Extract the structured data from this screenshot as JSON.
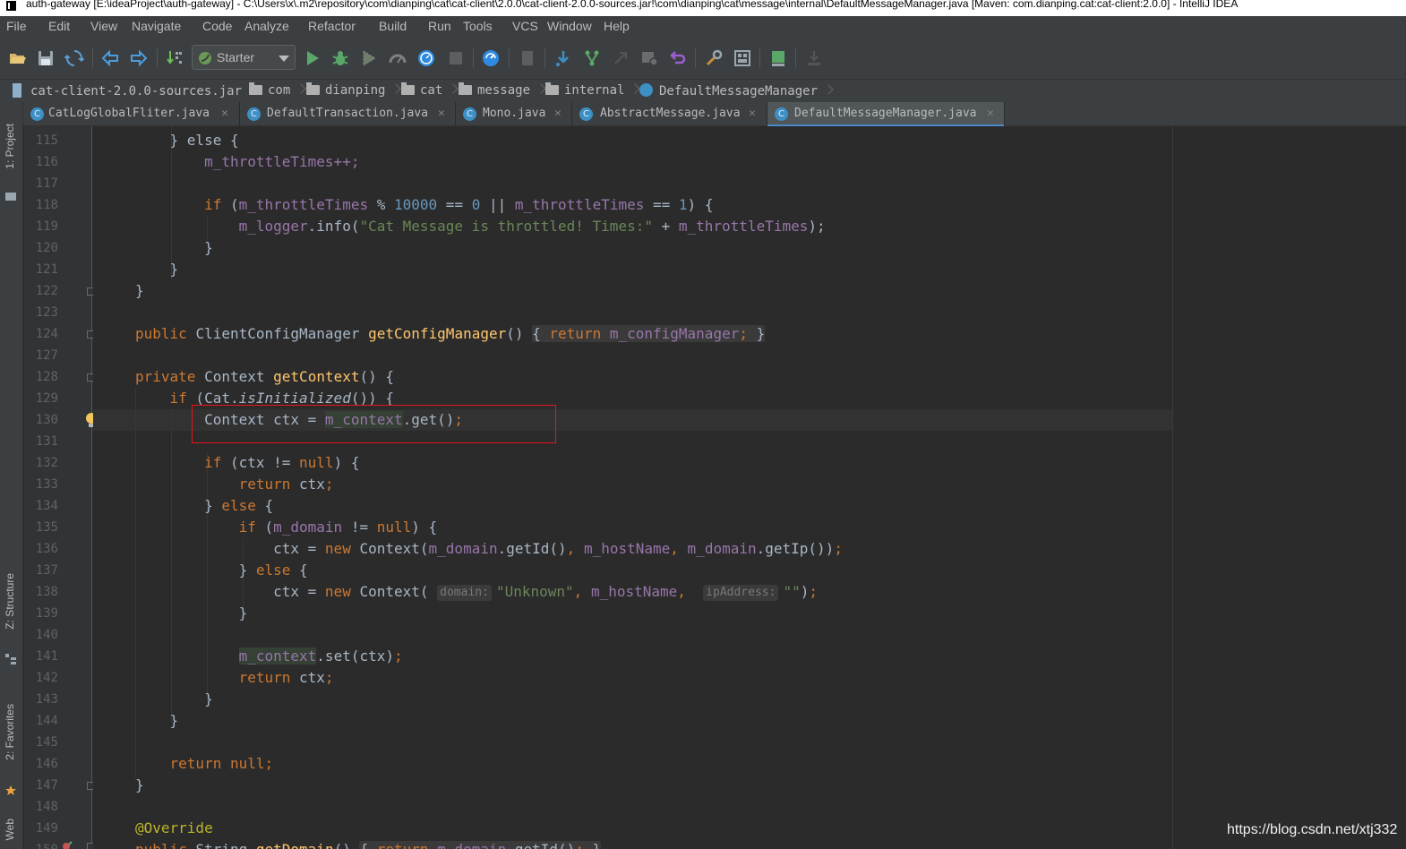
{
  "window": {
    "title": "auth-gateway [E:\\ideaProject\\auth-gateway] - C:\\Users\\x\\.m2\\repository\\com\\dianping\\cat\\cat-client\\2.0.0\\cat-client-2.0.0-sources.jar!\\com\\dianping\\cat\\message\\internal\\DefaultMessageManager.java [Maven: com.dianping.cat:cat-client:2.0.0] - IntelliJ IDEA"
  },
  "menu": [
    "File",
    "Edit",
    "View",
    "Navigate",
    "Code",
    "Analyze",
    "Refactor",
    "Build",
    "Run",
    "Tools",
    "VCS",
    "Window",
    "Help"
  ],
  "toolbar": {
    "run_config": "Starter"
  },
  "breadcrumbs": [
    "cat-client-2.0.0-sources.jar",
    "com",
    "dianping",
    "cat",
    "message",
    "internal",
    "DefaultMessageManager"
  ],
  "tabs": [
    {
      "label": "CatLogGlobalFliter.java"
    },
    {
      "label": "DefaultTransaction.java"
    },
    {
      "label": "Mono.java"
    },
    {
      "label": "AbstractMessage.java"
    },
    {
      "label": "DefaultMessageManager.java"
    }
  ],
  "active_tab": "DefaultMessageManager.java",
  "tool_windows": [
    "1: Project",
    "Z: Structure",
    "2: Favorites",
    "Web"
  ],
  "line_numbers": [
    "115",
    "116",
    "117",
    "118",
    "119",
    "120",
    "121",
    "122",
    "123",
    "124",
    "127",
    "128",
    "129",
    "130",
    "131",
    "132",
    "133",
    "134",
    "135",
    "136",
    "137",
    "138",
    "139",
    "140",
    "141",
    "142",
    "143",
    "144",
    "145",
    "146",
    "147",
    "148",
    "149",
    "150"
  ],
  "code": {
    "l115": "} else {",
    "l116": "m_throttleTimes++;",
    "l118_if": "if",
    "l118_f1": "m_throttleTimes",
    "l118_n1": "10000",
    "l118_n2": "0",
    "l118_f2": "m_throttleTimes",
    "l118_n3": "1",
    "l119_f": "m_logger",
    "l119_str": "\"Cat Message is throttled! Times:\"",
    "l119_f2": "m_throttleTimes",
    "l124_kw": "public",
    "l124_type": "ClientConfigManager",
    "l124_m": "getConfigManager",
    "l124_ret": "return",
    "l124_f": "m_configManager",
    "l128_kw": "private",
    "l128_type": "Context",
    "l128_m": "getContext",
    "l129_if": "if",
    "l129_call": "isInitialized",
    "l130_f": "m_context",
    "l132_if": "if",
    "l132_null": "null",
    "l133_ret": "return",
    "l134_else": "else",
    "l135_if": "if",
    "l135_f": "m_domain",
    "l135_null": "null",
    "l136_new": "new",
    "l136_f1": "m_domain",
    "l136_f2": "m_hostName",
    "l136_f3": "m_domain",
    "l137_else": "else",
    "l138_new": "new",
    "l138_hint1": "domain:",
    "l138_str1": "\"Unknown\"",
    "l138_f": "m_hostName",
    "l138_hint2": "ipAddress:",
    "l138_str2": "\"\"",
    "l141_f": "m_context",
    "l142_ret": "return",
    "l146_ret": "return",
    "l146_null": "null",
    "l149_ann": "@Override",
    "l150_kw": "public",
    "l150_type": "String",
    "l150_m": "getDomain",
    "l150_ret": "return",
    "l150_f": "m_domain"
  },
  "highlighted_line": "130",
  "watermark": "https://blog.csdn.net/xtj332",
  "colors": {
    "editor_bg": "#2b2b2b",
    "keyword": "#cc7832",
    "field": "#9876aa",
    "number": "#6897bb",
    "string": "#6a8759",
    "method": "#ffc66d",
    "annotation_box": "#e8141b"
  }
}
